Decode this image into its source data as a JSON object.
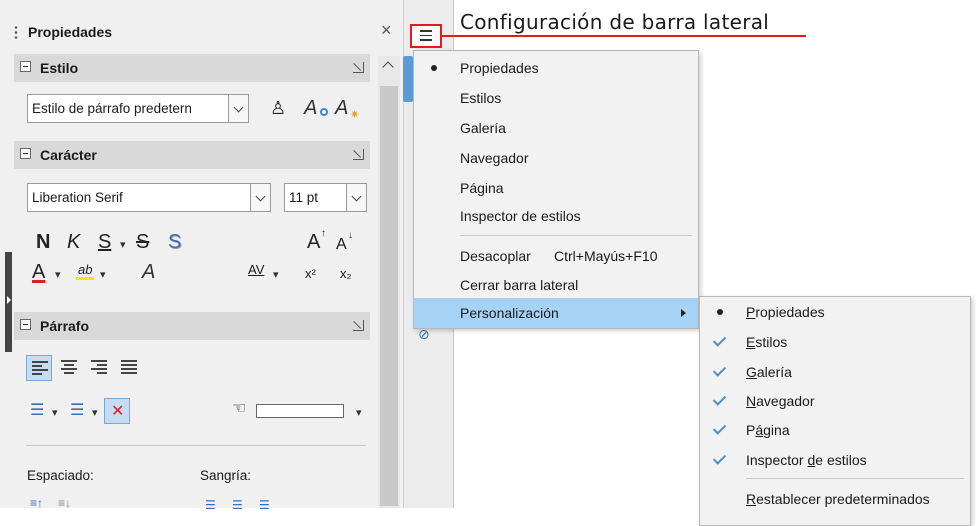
{
  "deck": {
    "title": "Propiedades",
    "sections": {
      "estilo": "Estilo",
      "caracter": "Carácter",
      "parrafo": "Párrafo"
    },
    "paragraph_style_value": "Estilo de párrafo predetern",
    "font_name_value": "Liberation Serif",
    "font_size_value": "11 pt",
    "char": {
      "bold": "N",
      "italic": "K",
      "underline": "S",
      "strike": "S",
      "shadow": "S",
      "grow": "A",
      "shrink": "A",
      "font_color": "A",
      "highlight": "ab",
      "clear": "A",
      "spacing": "AV",
      "superscript": "x²",
      "subscript": "x₂"
    },
    "spacing_label": "Espaciado:",
    "indent_label": "Sangría:"
  },
  "callout_text": "Configuración de barra lateral",
  "menu": {
    "items": [
      {
        "label": "Propiedades"
      },
      {
        "label": "Estilos"
      },
      {
        "label": "Galería"
      },
      {
        "label": "Navegador"
      },
      {
        "label": "Página"
      },
      {
        "label": "Inspector de estilos"
      }
    ],
    "undock": "Desacoplar",
    "undock_shortcut": "Ctrl+Mayús+F10",
    "close_sidebar": "Cerrar barra lateral",
    "customize": "Personalización"
  },
  "submenu": {
    "items": [
      {
        "pre": "",
        "u": "P",
        "post": "ropiedades"
      },
      {
        "pre": "",
        "u": "E",
        "post": "stilos"
      },
      {
        "pre": "",
        "u": "G",
        "post": "alería"
      },
      {
        "pre": "",
        "u": "N",
        "post": "avegador"
      },
      {
        "pre": "P",
        "u": "á",
        "post": "gina"
      },
      {
        "pre": "Inspector ",
        "u": "d",
        "post": "e estilos"
      }
    ],
    "reset_u": "R",
    "reset_rest": "establecer predeterminados"
  },
  "colors": {
    "highlight": "#a6d2f5",
    "callout_red": "#e21b1b",
    "check_blue": "#4a8fd6"
  }
}
